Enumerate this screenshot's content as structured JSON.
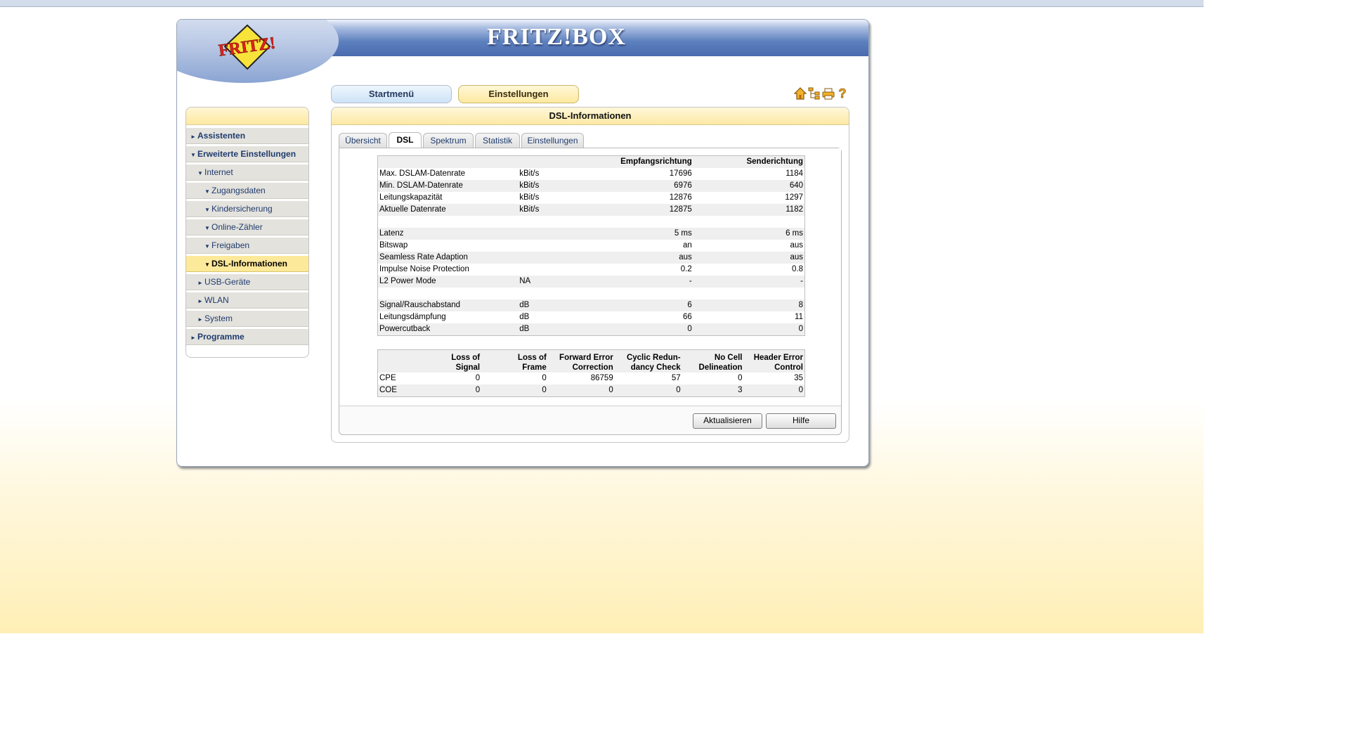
{
  "app": {
    "brand": "FRITZ!",
    "product": "FRITZ!BOX"
  },
  "nav": {
    "start": "Startmenü",
    "settings": "Einstellungen"
  },
  "icons": [
    "home-icon",
    "sitemap-icon",
    "print-icon",
    "help-icon"
  ],
  "sidebar": {
    "items": [
      {
        "label": "Assistenten",
        "level": 0,
        "arrow": "►"
      },
      {
        "label": "Erweiterte Einstellungen",
        "level": 0,
        "arrow": "▼"
      },
      {
        "label": "Internet",
        "level": 1,
        "arrow": "▼"
      },
      {
        "label": "Zugangsdaten",
        "level": 2,
        "arrow": "▼"
      },
      {
        "label": "Kindersicherung",
        "level": 2,
        "arrow": "▼"
      },
      {
        "label": "Online-Zähler",
        "level": 2,
        "arrow": "▼"
      },
      {
        "label": "Freigaben",
        "level": 2,
        "arrow": "▼"
      },
      {
        "label": "DSL-Informationen",
        "level": 2,
        "arrow": "▼",
        "active": true
      },
      {
        "label": "USB-Geräte",
        "level": 1,
        "arrow": "►"
      },
      {
        "label": "WLAN",
        "level": 1,
        "arrow": "►"
      },
      {
        "label": "System",
        "level": 1,
        "arrow": "►"
      },
      {
        "label": "Programme",
        "level": 0,
        "arrow": "►"
      }
    ]
  },
  "panel": {
    "title": "DSL-Informationen",
    "tabs": [
      "Übersicht",
      "DSL",
      "Spektrum",
      "Statistik",
      "Einstellungen"
    ],
    "active_tab": "DSL"
  },
  "dsl_table": {
    "headers": [
      "",
      "",
      "Empfangsrichtung",
      "Senderichtung"
    ],
    "rows": [
      [
        "Max. DSLAM-Datenrate",
        "kBit/s",
        "17696",
        "1184"
      ],
      [
        "Min. DSLAM-Datenrate",
        "kBit/s",
        "6976",
        "640"
      ],
      [
        "Leitungskapazität",
        "kBit/s",
        "12876",
        "1297"
      ],
      [
        "Aktuelle Datenrate",
        "kBit/s",
        "12875",
        "1182"
      ],
      [
        "",
        "",
        "",
        ""
      ],
      [
        "Latenz",
        "",
        "5 ms",
        "6 ms"
      ],
      [
        "Bitswap",
        "",
        "an",
        "aus"
      ],
      [
        "Seamless Rate Adaption",
        "",
        "aus",
        "aus"
      ],
      [
        "Impulse Noise Protection",
        "",
        "0.2",
        "0.8"
      ],
      [
        "L2 Power Mode",
        "NA",
        "-",
        "-"
      ],
      [
        "",
        "",
        "",
        ""
      ],
      [
        "Signal/Rauschabstand",
        "dB",
        "6",
        "8"
      ],
      [
        "Leitungsdämpfung",
        "dB",
        "66",
        "11"
      ],
      [
        "Powercutback",
        "dB",
        "0",
        "0"
      ]
    ]
  },
  "error_table": {
    "headers": [
      [
        "",
        ""
      ],
      [
        "Loss of",
        "Signal"
      ],
      [
        "Loss of",
        "Frame"
      ],
      [
        "Forward Error",
        "Correction"
      ],
      [
        "Cyclic Redun-",
        "dancy Check"
      ],
      [
        "No Cell",
        "Delineation"
      ],
      [
        "Header Error",
        "Control"
      ]
    ],
    "rows": [
      [
        "CPE",
        "0",
        "0",
        "86759",
        "57",
        "0",
        "35"
      ],
      [
        "COE",
        "0",
        "0",
        "0",
        "0",
        "3",
        "0"
      ]
    ]
  },
  "buttons": {
    "refresh": "Aktualisieren",
    "help": "Hilfe"
  }
}
